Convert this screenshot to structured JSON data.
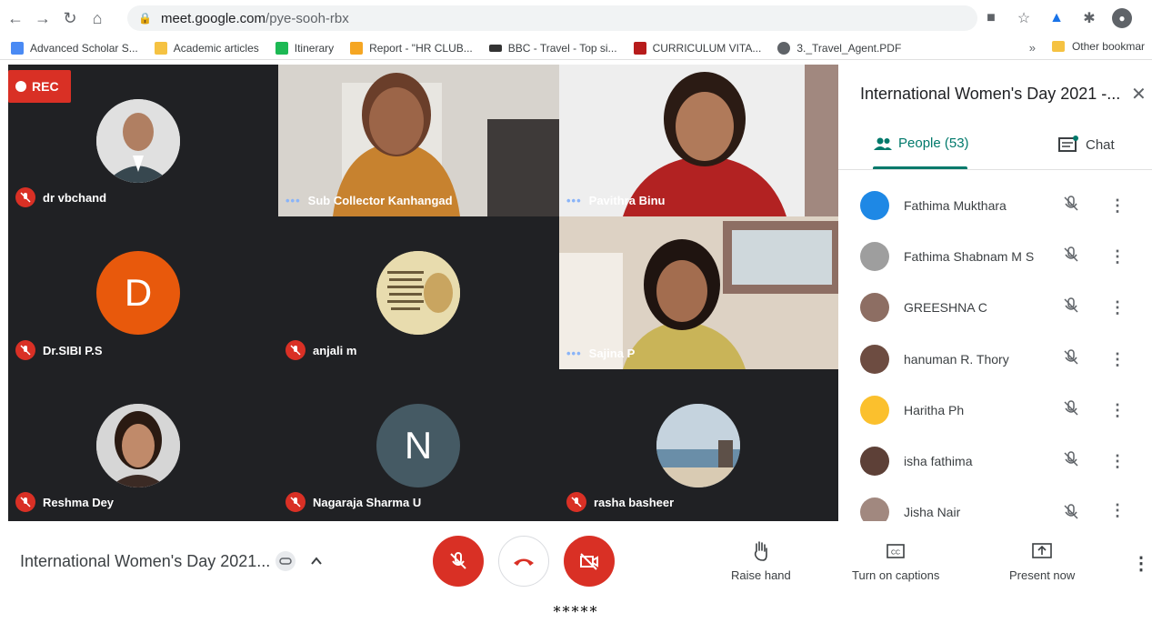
{
  "browser": {
    "url_host": "meet.google.com",
    "url_path": "/pye-sooh-rbx",
    "bookmarks": [
      {
        "label": "Advanced Scholar S...",
        "color": "#4a8af4"
      },
      {
        "label": "Academic articles",
        "color": "#f5c242"
      },
      {
        "label": "Itinerary",
        "color": "#1db954"
      },
      {
        "label": "Report - \"HR CLUB...",
        "color": "#f5a623"
      },
      {
        "label": "BBC - Travel - Top si...",
        "color": "#333333"
      },
      {
        "label": "CURRICULUM VITA...",
        "color": "#b71c1c"
      },
      {
        "label": "3._Travel_Agent.PDF",
        "color": "#5f6368"
      }
    ],
    "more_label": "»",
    "other_bookmarks": "Other bookmar"
  },
  "grid": {
    "rec_label": "REC",
    "tiles": [
      {
        "name": "dr vbchand",
        "muted": true
      },
      {
        "name": "Sub Collector Kanhangad",
        "muted": false
      },
      {
        "name": "Pavithra Binu",
        "muted": false
      },
      {
        "name": "Dr.SIBI P.S",
        "muted": true,
        "initial": "D",
        "color": "#e8590c"
      },
      {
        "name": "anjali m",
        "muted": true
      },
      {
        "name": "Sajina P",
        "muted": false
      },
      {
        "name": "Reshma Dey",
        "muted": true
      },
      {
        "name": "Nagaraja Sharma U",
        "muted": true,
        "initial": "N",
        "color": "#455a64"
      },
      {
        "name": "rasha basheer",
        "muted": true
      }
    ]
  },
  "panel": {
    "title": "International Women's Day 2021 -...",
    "people_tab": "People (53)",
    "chat_tab": "Chat",
    "people": [
      {
        "name": "Fathima Mukthara",
        "color": "#1e88e5"
      },
      {
        "name": "Fathima Shabnam M S",
        "color": "#9e9e9e"
      },
      {
        "name": "GREESHNA C",
        "color": "#8d6e63"
      },
      {
        "name": "hanuman R. Thory",
        "color": "#6d4c41"
      },
      {
        "name": "Haritha Ph",
        "color": "#fbc02d"
      },
      {
        "name": "isha fathima",
        "color": "#5d4037"
      },
      {
        "name": "Jisha Nair",
        "color": "#a1887f"
      }
    ]
  },
  "controls": {
    "meeting_title": "International Women's Day 2021...",
    "raise_hand": "Raise hand",
    "captions": "Turn on captions",
    "present": "Present now"
  },
  "footer": {
    "stars": "*****"
  }
}
